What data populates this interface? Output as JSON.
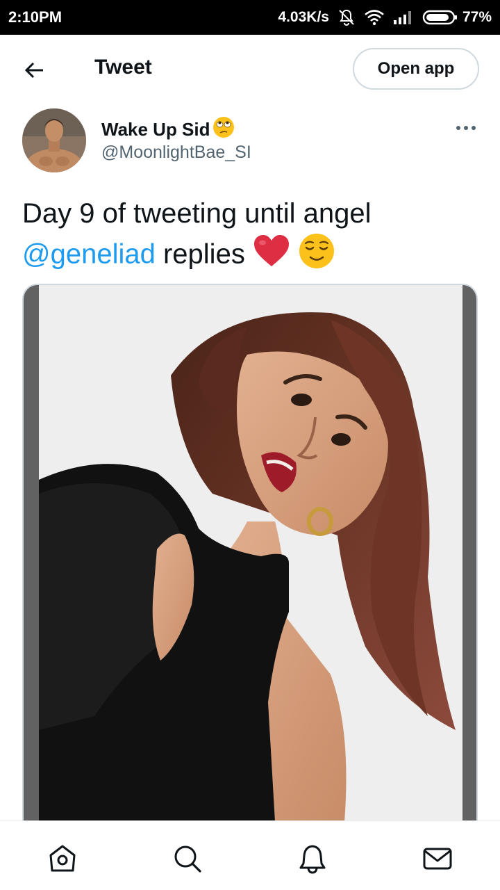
{
  "status_bar": {
    "time": "2:10PM",
    "network_speed": "4.03K/s",
    "battery_percent": "77%",
    "icons": [
      "mute-icon",
      "wifi-icon",
      "signal-icon",
      "battery-icon"
    ]
  },
  "header": {
    "title": "Tweet",
    "open_app_label": "Open app"
  },
  "author": {
    "name": "Wake Up Sid",
    "name_emoji": "face-with-rolling-eyes",
    "handle": "@MoonlightBae_SI"
  },
  "tweet": {
    "text_before": "Day 9 of tweeting until angel",
    "mention": "@geneliad",
    "text_after": "replies",
    "emojis": [
      "red-heart",
      "relieved-face"
    ]
  },
  "bottom_nav": {
    "items": [
      "home-icon",
      "search-icon",
      "notifications-icon",
      "messages-icon"
    ]
  },
  "colors": {
    "mention": "#1d9bf0",
    "handle": "#536471",
    "border": "#cfd9de",
    "status_bar_bg": "#000000"
  }
}
